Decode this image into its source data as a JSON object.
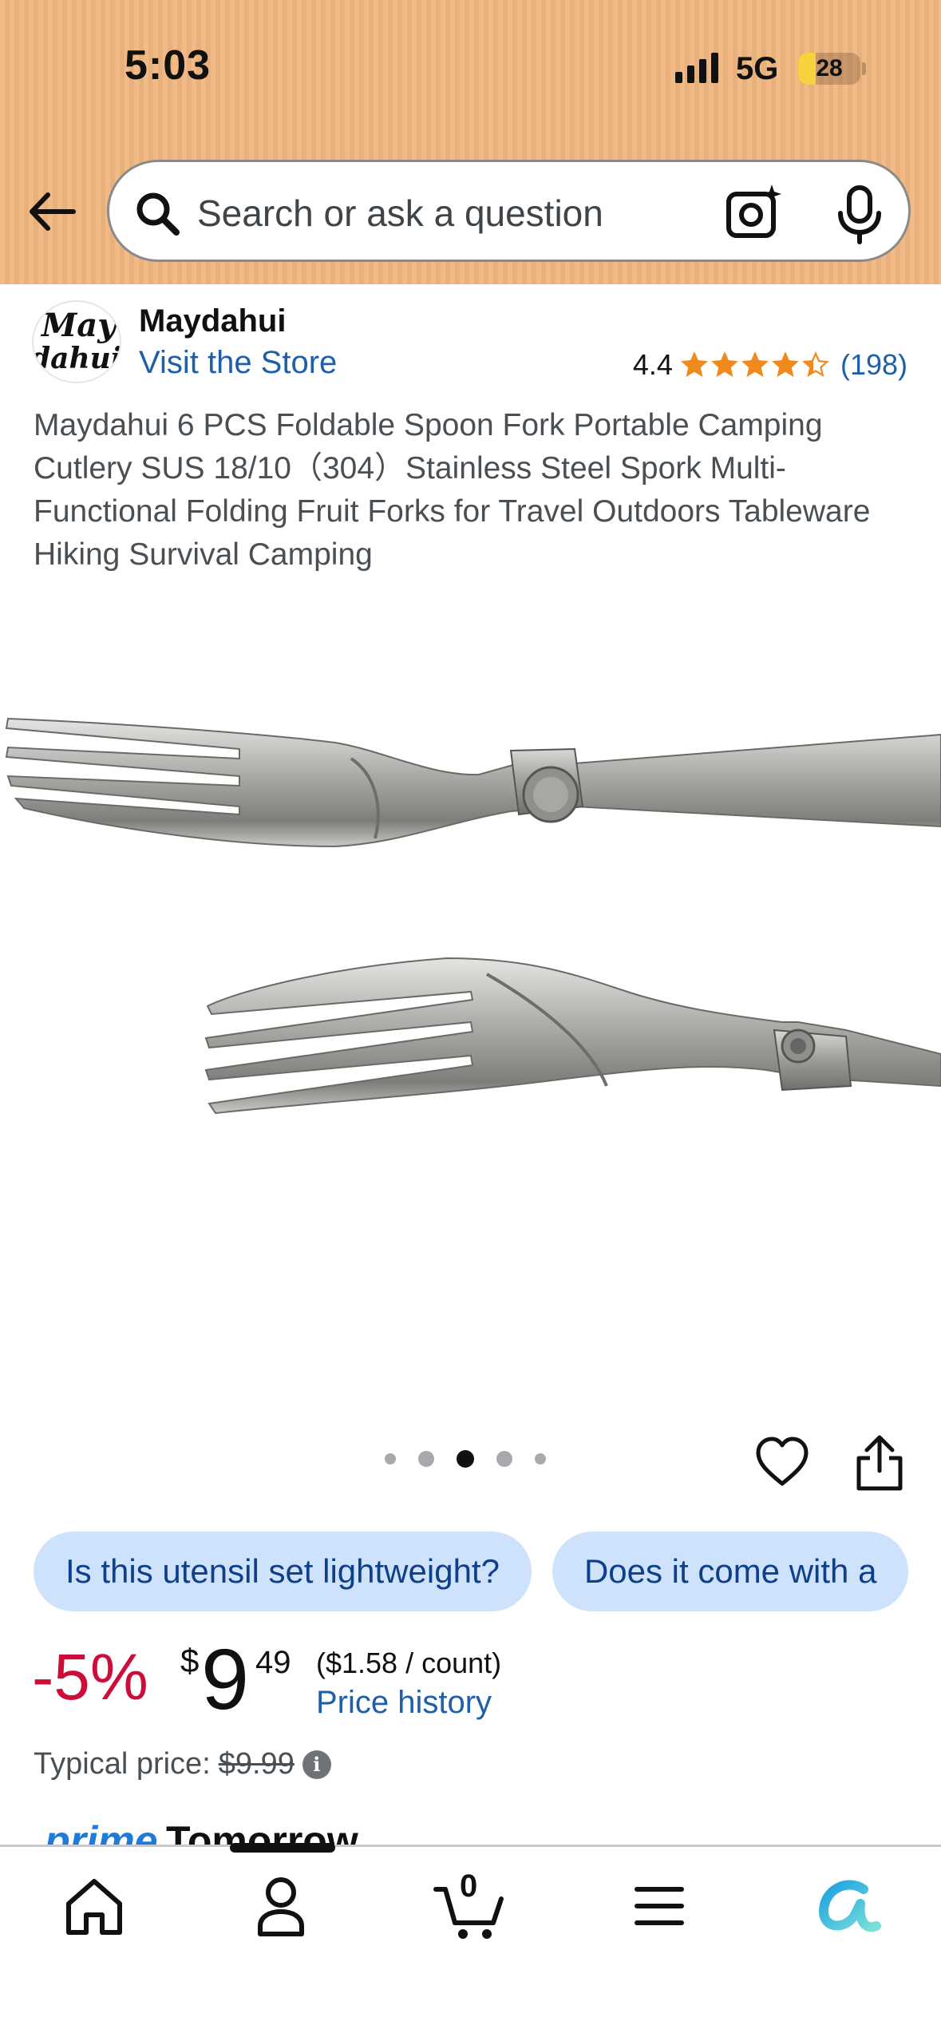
{
  "status_bar": {
    "time": "5:03",
    "network": "5G",
    "battery_level": "28"
  },
  "search": {
    "placeholder": "Search or ask a question"
  },
  "brand": {
    "logo_line1": "May",
    "logo_line2": "dahui",
    "name": "Maydahui",
    "store_link": "Visit the Store"
  },
  "rating": {
    "value": "4.4",
    "stars": 4.4,
    "count": "(198)"
  },
  "product": {
    "title": "Maydahui 6 PCS Foldable Spoon Fork Portable Camping Cutlery SUS 18/10（304）Stainless Steel Spork Multi-Functional Folding Fruit Forks for Travel Outdoors Tableware Hiking Survival Camping"
  },
  "carousel": {
    "active_index": 2,
    "count": 5
  },
  "chips": [
    "Is this utensil set lightweight?",
    "Does it come with a"
  ],
  "price": {
    "discount": "-5%",
    "currency": "$",
    "whole": "9",
    "fraction": "49",
    "unit_price": "($1.58 / count)",
    "history_link": "Price history",
    "typical_label": "Typical price:",
    "typical_value": "$9.99"
  },
  "delivery": {
    "prime_label": "prime",
    "day": "Tomorrow"
  },
  "tabbar": {
    "cart_count": "0"
  },
  "colors": {
    "header_bg": "#f0b67f",
    "link": "#1f5ea8",
    "discount": "#cc0c39",
    "star": "#f08a1c",
    "chip_bg": "#cfe2fb"
  }
}
